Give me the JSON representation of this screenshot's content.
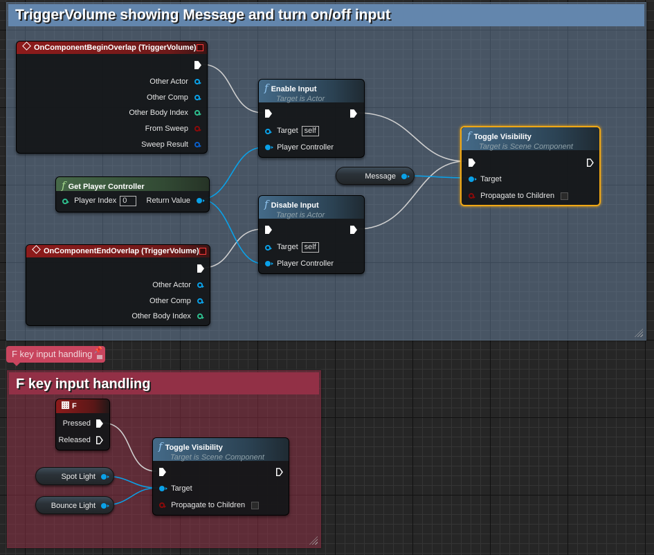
{
  "comments": {
    "trigger": {
      "title": "TriggerVolume showing Message and turn on/off input",
      "color": "#6386ad"
    },
    "fkey": {
      "title": "F key input handling",
      "color": "#923046",
      "bubble": "F key input handling"
    }
  },
  "nodes": {
    "begin_overlap": {
      "title": "OnComponentBeginOverlap (TriggerVolume)",
      "outputs": [
        "Other Actor",
        "Other Comp",
        "Other Body Index",
        "From Sweep",
        "Sweep Result"
      ]
    },
    "end_overlap": {
      "title": "OnComponentEndOverlap (TriggerVolume)",
      "outputs": [
        "Other Actor",
        "Other Comp",
        "Other Body Index"
      ]
    },
    "get_player_controller": {
      "title": "Get Player Controller",
      "input_label": "Player Index",
      "input_value": "0",
      "output_label": "Return Value"
    },
    "enable_input": {
      "title": "Enable Input",
      "subtitle": "Target is Actor",
      "target_label": "Target",
      "target_value": "self",
      "pc_label": "Player Controller"
    },
    "disable_input": {
      "title": "Disable Input",
      "subtitle": "Target is Actor",
      "target_label": "Target",
      "target_value": "self",
      "pc_label": "Player Controller"
    },
    "toggle_visibility_1": {
      "title": "Toggle Visibility",
      "subtitle": "Target is Scene Component",
      "target_label": "Target",
      "propagate_label": "Propagate to Children",
      "propagate_checked": false
    },
    "toggle_visibility_2": {
      "title": "Toggle Visibility",
      "subtitle": "Target is Scene Component",
      "target_label": "Target",
      "propagate_label": "Propagate to Children",
      "propagate_checked": false
    },
    "f_key": {
      "title": "F",
      "pressed_label": "Pressed",
      "released_label": "Released"
    },
    "message_var": {
      "label": "Message"
    },
    "spot_light_var": {
      "label": "Spot Light"
    },
    "bounce_light_var": {
      "label": "Bounce Light"
    }
  },
  "colors": {
    "exec_wire": "#cfcfcf",
    "object_wire": "#0aa1e8",
    "selected_border": "#f0a815"
  }
}
